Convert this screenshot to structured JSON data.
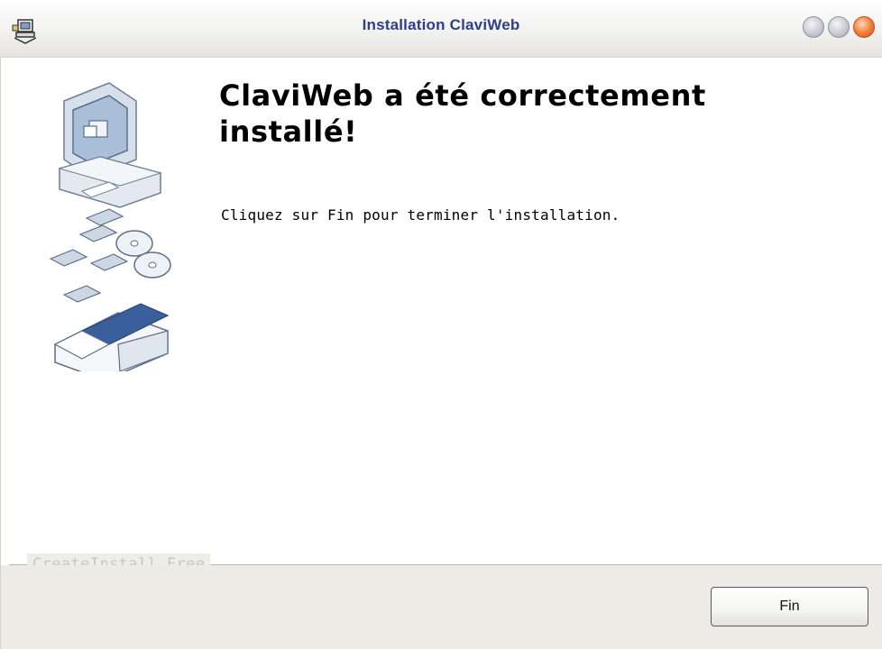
{
  "window": {
    "title": "Installation ClaviWeb",
    "icons": {
      "app": "installer-app-icon",
      "minimize": "minimize-icon",
      "maximize": "maximize-icon",
      "close": "close-icon"
    }
  },
  "main": {
    "heading": "ClaviWeb a été correctement installé!",
    "message": "Cliquez sur Fin pour terminer l'installation.",
    "illustration": "computer-disks-box-illustration"
  },
  "footer": {
    "brand": "CreateInstall Free",
    "finish_label": "Fin"
  },
  "colors": {
    "title_text": "#2b3f8c",
    "close_button": "#f2823c",
    "footer_bg": "#ecebe6"
  }
}
